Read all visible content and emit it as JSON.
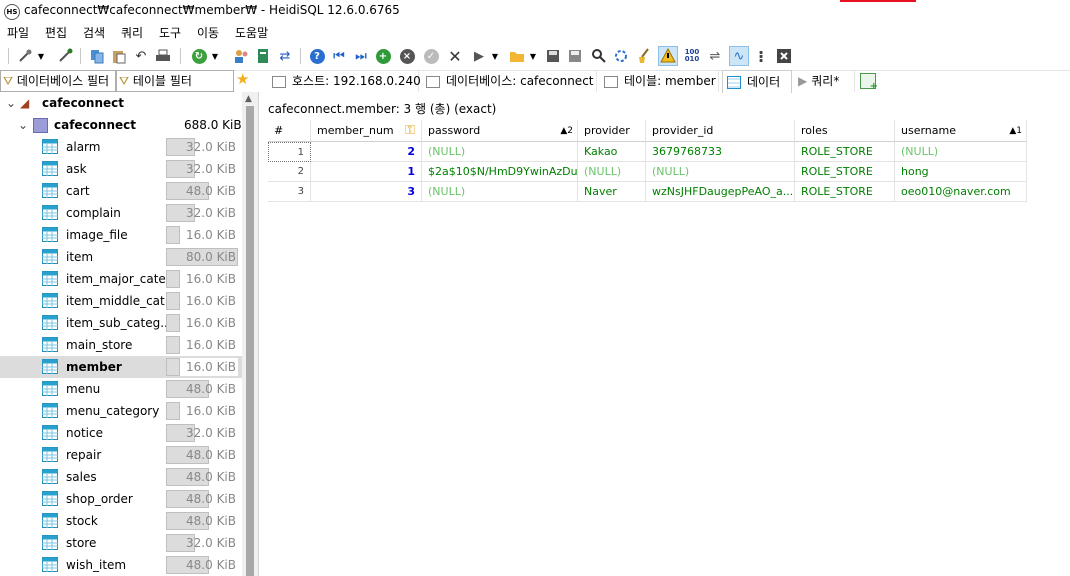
{
  "window": {
    "title": "cafeconnect₩cafeconnect₩member₩ - HeidiSQL 12.6.0.6765",
    "app_icon": "HS"
  },
  "menu": [
    "파일",
    "편집",
    "검색",
    "쿼리",
    "도구",
    "이동",
    "도움말"
  ],
  "filters": {
    "database_filter": "데이터베이스 필터",
    "table_filter": "테이블 필터"
  },
  "tabs": {
    "host": "호스트: 192.168.0.240",
    "database": "데이터베이스: cafeconnect",
    "table": "테이블: member",
    "data": "데이터",
    "query": "쿼리*"
  },
  "tree": {
    "server": "cafeconnect",
    "database": "cafeconnect",
    "database_size": "688.0 KiB",
    "tables": [
      {
        "name": "alarm",
        "size": "32.0 KiB",
        "fill": 0.4
      },
      {
        "name": "ask",
        "size": "32.0 KiB",
        "fill": 0.4
      },
      {
        "name": "cart",
        "size": "48.0 KiB",
        "fill": 0.6
      },
      {
        "name": "complain",
        "size": "32.0 KiB",
        "fill": 0.4
      },
      {
        "name": "image_file",
        "size": "16.0 KiB",
        "fill": 0.2
      },
      {
        "name": "item",
        "size": "80.0 KiB",
        "fill": 1.0
      },
      {
        "name": "item_major_cate...",
        "size": "16.0 KiB",
        "fill": 0.2
      },
      {
        "name": "item_middle_cat...",
        "size": "16.0 KiB",
        "fill": 0.2
      },
      {
        "name": "item_sub_categ...",
        "size": "16.0 KiB",
        "fill": 0.2
      },
      {
        "name": "main_store",
        "size": "16.0 KiB",
        "fill": 0.2
      },
      {
        "name": "member",
        "size": "16.0 KiB",
        "fill": 0.2
      },
      {
        "name": "menu",
        "size": "48.0 KiB",
        "fill": 0.6
      },
      {
        "name": "menu_category",
        "size": "16.0 KiB",
        "fill": 0.2
      },
      {
        "name": "notice",
        "size": "32.0 KiB",
        "fill": 0.4
      },
      {
        "name": "repair",
        "size": "48.0 KiB",
        "fill": 0.6
      },
      {
        "name": "sales",
        "size": "48.0 KiB",
        "fill": 0.6
      },
      {
        "name": "shop_order",
        "size": "48.0 KiB",
        "fill": 0.6
      },
      {
        "name": "stock",
        "size": "48.0 KiB",
        "fill": 0.6
      },
      {
        "name": "store",
        "size": "32.0 KiB",
        "fill": 0.4
      },
      {
        "name": "wish_item",
        "size": "48.0 KiB",
        "fill": 0.6
      }
    ],
    "selected": "member"
  },
  "query_label": "cafeconnect.member: 3 행 (총) (exact)",
  "grid": {
    "columns": [
      "#",
      "member_num",
      "password",
      "provider",
      "provider_id",
      "roles",
      "username"
    ],
    "sort_indicators": {
      "password": "▲2",
      "username": "▲1"
    },
    "rows": [
      {
        "rownum": "1",
        "member_num": "2",
        "password": "(NULL)",
        "provider": "Kakao",
        "provider_id": "3679768733",
        "roles": "ROLE_STORE",
        "username": "(NULL)"
      },
      {
        "rownum": "2",
        "member_num": "1",
        "password": "$2a$10$N/HmD9YwinAzDu...",
        "provider": "(NULL)",
        "provider_id": "(NULL)",
        "roles": "ROLE_STORE",
        "username": "hong"
      },
      {
        "rownum": "3",
        "member_num": "3",
        "password": "(NULL)",
        "provider": "Naver",
        "provider_id": "wzNsJHFDaugepPeAO_a...",
        "roles": "ROLE_STORE",
        "username": "oeo010@naver.com"
      }
    ]
  },
  "colors": {
    "null_text": "#6ac46a",
    "text_value": "#008000",
    "number_value": "#0000e0",
    "selection": "#dcdcdc"
  }
}
